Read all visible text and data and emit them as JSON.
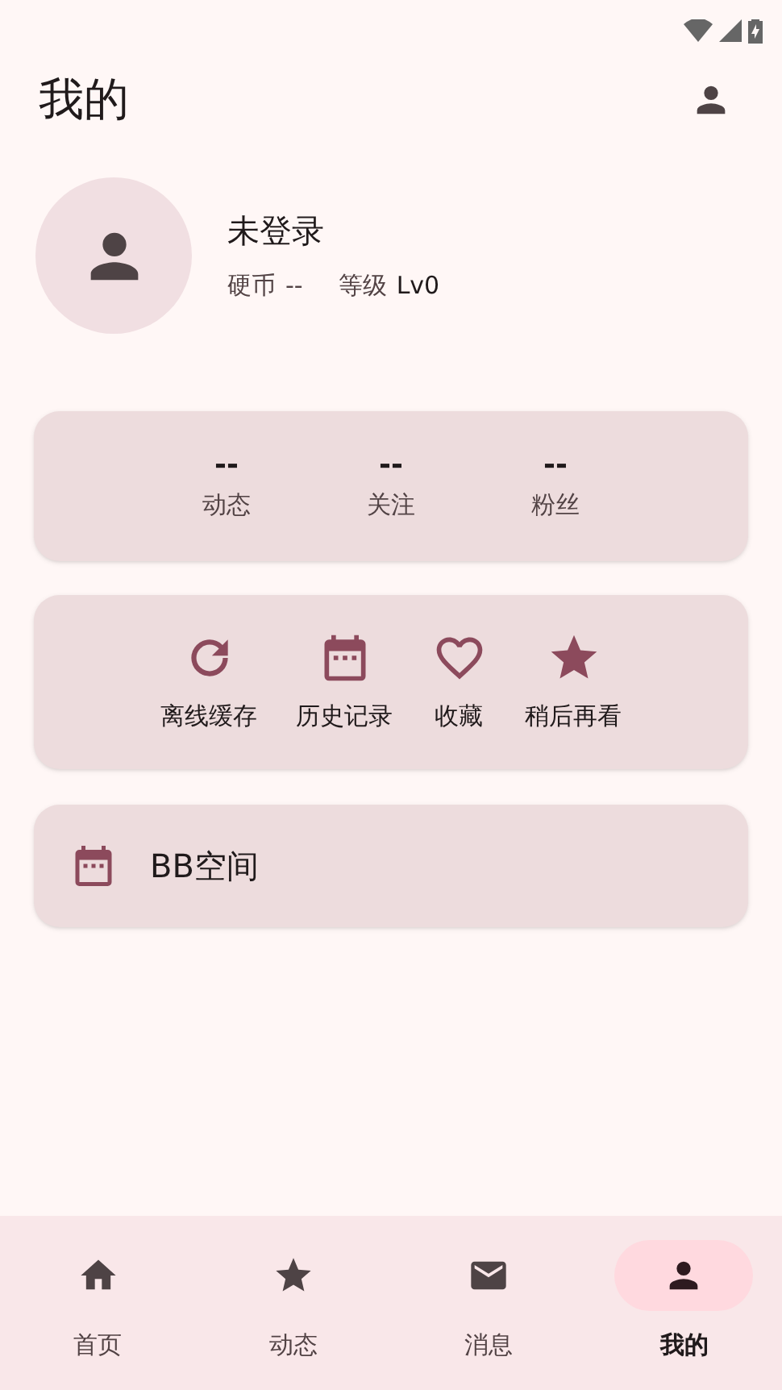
{
  "header": {
    "title": "我的"
  },
  "profile": {
    "name": "未登录",
    "coins_label": "硬币",
    "coins": "--",
    "level_label": "等级",
    "level_value": "Lv0"
  },
  "stats": [
    {
      "value": "--",
      "label": "动态"
    },
    {
      "value": "--",
      "label": "关注"
    },
    {
      "value": "--",
      "label": "粉丝"
    }
  ],
  "shortcuts": [
    {
      "kind": "refresh",
      "label": "离线缓存"
    },
    {
      "kind": "calendar",
      "label": "历史记录"
    },
    {
      "kind": "heart",
      "label": "收藏"
    },
    {
      "kind": "star",
      "label": "稍后再看"
    }
  ],
  "space_item": {
    "kind": "calendar",
    "label": "BB空间"
  },
  "bottom_nav": [
    {
      "kind": "home",
      "label": "首页",
      "selected": false
    },
    {
      "kind": "star",
      "label": "动态",
      "selected": false
    },
    {
      "kind": "mail",
      "label": "消息",
      "selected": false
    },
    {
      "kind": "person",
      "label": "我的",
      "selected": true
    }
  ]
}
